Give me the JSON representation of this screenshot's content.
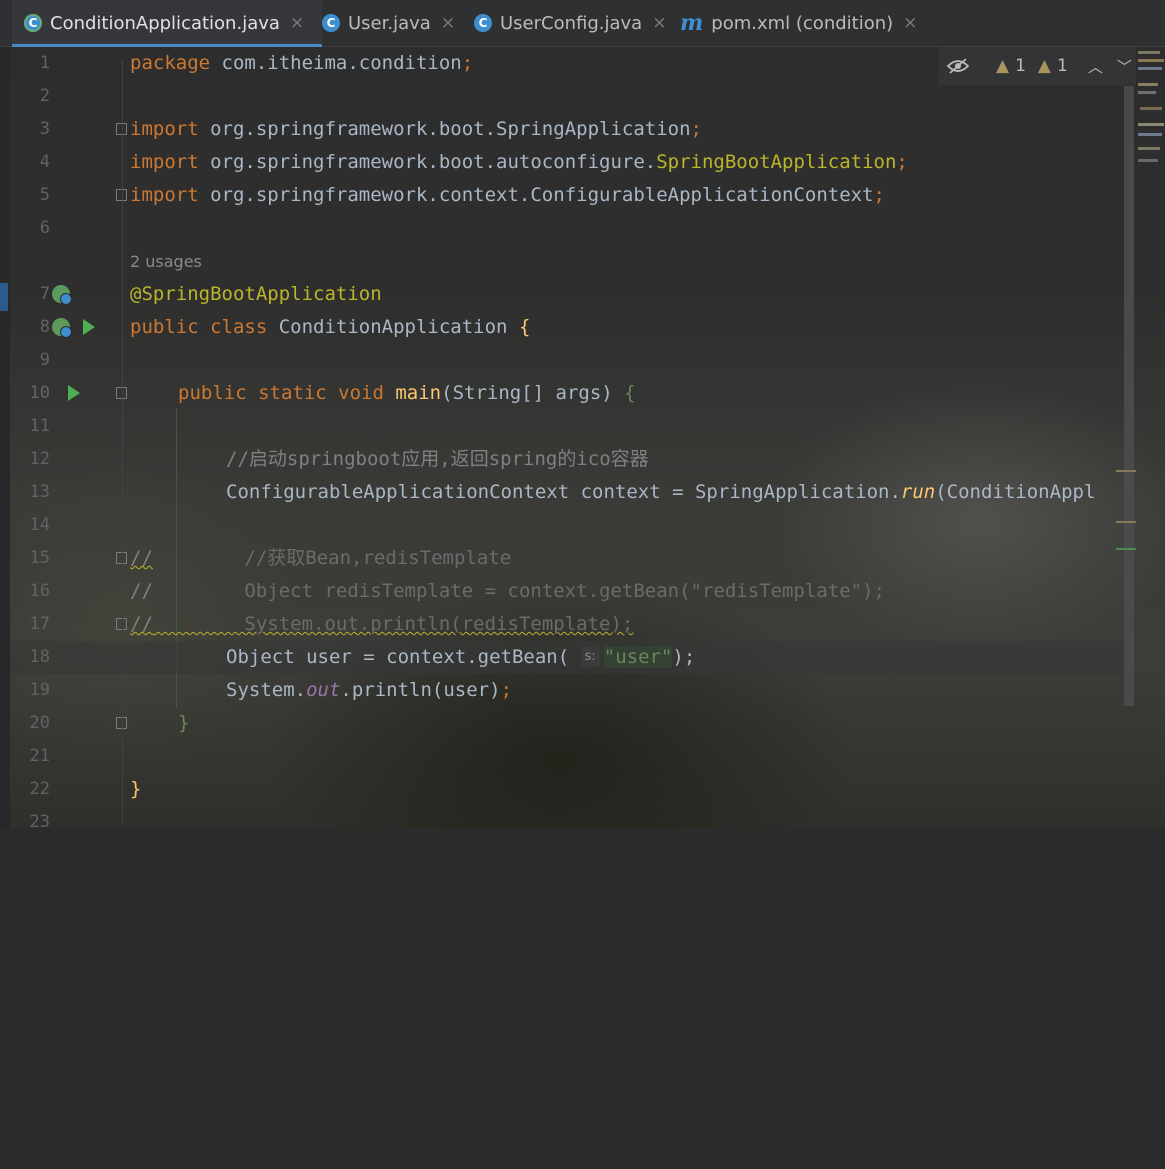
{
  "tabs": [
    {
      "label": "ConditionApplication.java",
      "icon": "spring-class-icon",
      "active": true
    },
    {
      "label": "User.java",
      "icon": "class-icon",
      "active": false
    },
    {
      "label": "UserConfig.java",
      "icon": "class-icon",
      "active": false
    },
    {
      "label": "pom.xml (condition)",
      "icon": "maven-icon",
      "active": false
    }
  ],
  "tab_icon_letters": {
    "class": "C",
    "maven": "m"
  },
  "close_glyph": "×",
  "inspections": {
    "warnings_a": "1",
    "warnings_b": "1"
  },
  "line_numbers": [
    "1",
    "2",
    "3",
    "4",
    "5",
    "6",
    "",
    "7",
    "8",
    "9",
    "10",
    "11",
    "12",
    "13",
    "14",
    "15",
    "16",
    "17",
    "18",
    "19",
    "20",
    "21",
    "22",
    "23"
  ],
  "current_line": "18",
  "code": {
    "l1_kw": "package",
    "l1_rest": " com.itheima.condition",
    "semicolon": ";",
    "import_kw": "import",
    "l3_rest": " org.springframework.boot.SpringApplication",
    "l4_pre": " org.springframework.boot.autoconfigure.",
    "l4_ann": "SpringBootApplication",
    "l5_rest": " org.springframework.context.ConfigurableApplicationContext",
    "usages": "2 usages",
    "l7_ann": "@SpringBootApplication",
    "l8_kw": "public class",
    "l8_name": " ConditionApplication ",
    "brace_open": "{",
    "brace_close": "}",
    "l10_kw": "public static void",
    "l10_fn": "main",
    "l10_params": "(String[] args) ",
    "l12_comment": "//启动springboot应用,返回spring的ico容器",
    "l13_pre": "ConfigurableApplicationContext context = SpringApplication.",
    "l13_run": "run",
    "l13_post": "(ConditionAppl",
    "l15_slash": "//",
    "l15_rest": "        //获取Bean,redisTemplate",
    "l16_slash": "//",
    "l16_rest": "        Object redisTemplate = context.getBean(\"redisTemplate\");",
    "l17_slash": "//",
    "l17_rest": "        System.out.println(redisTemplate);",
    "l18_pre": "Object user = context.getBean( ",
    "l18_hint": "s:",
    "l18_str": "\"user\"",
    "l18_post": ");",
    "l19_pre": "System.",
    "l19_out": "out",
    "l19_post": ".println(user)"
  },
  "colors": {
    "keyword": "#cc7832",
    "annotation": "#bbb529",
    "string": "#6a8759",
    "comment": "#808080",
    "method": "#ffc66d",
    "static_field": "#9876aa",
    "accent": "#4a88c7"
  }
}
